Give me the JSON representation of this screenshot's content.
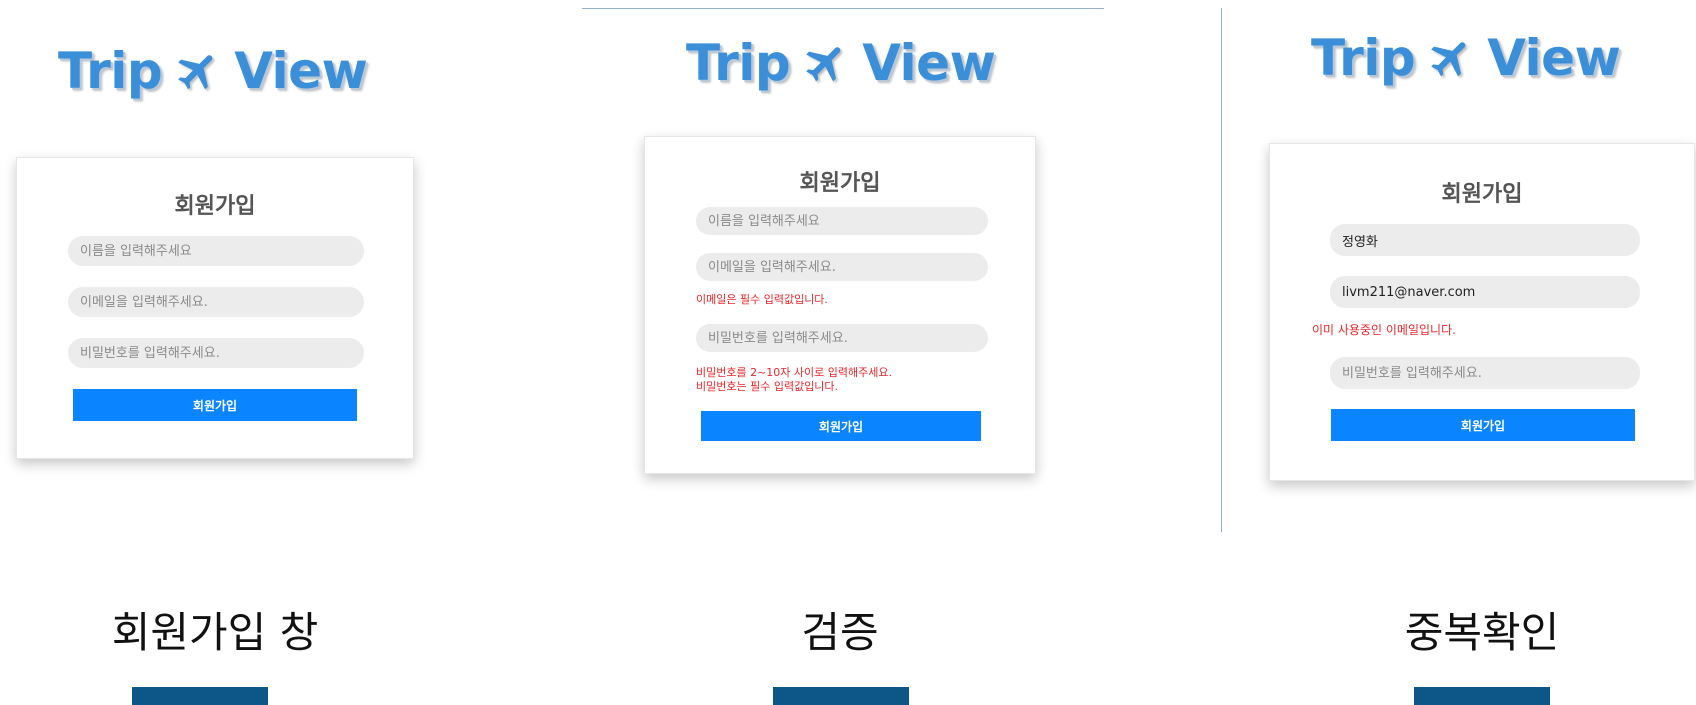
{
  "logo": {
    "part1": "Trip",
    "part2": "View"
  },
  "panels": [
    {
      "title": "회원가입",
      "name_placeholder": "이름을 입력해주세요",
      "email_placeholder": "이메일을 입력해주세요.",
      "password_placeholder": "비밀번호를 입력해주세요.",
      "button_label": "회원가입",
      "caption": "회원가입 창"
    },
    {
      "title": "회원가입",
      "name_placeholder": "이름을 입력해주세요",
      "email_placeholder": "이메일을 입력해주세요.",
      "email_error": "이메일은 필수 입력값입니다.",
      "password_placeholder": "비밀번호를 입력해주세요.",
      "password_error_1": "비밀번호를 2~10자 사이로 입력해주세요.",
      "password_error_2": "비밀번호는 필수 입력값입니다.",
      "button_label": "회원가입",
      "caption": "검증"
    },
    {
      "title": "회원가입",
      "name_value": "정영화",
      "email_value": "livm211@naver.com",
      "email_error": "이미 사용중인 이메일입니다.",
      "password_placeholder": "비밀번호를 입력해주세요.",
      "button_label": "회원가입",
      "caption": "중복확인"
    }
  ],
  "colors": {
    "logo": "#3a8fd8",
    "button": "#0b84ff",
    "error": "#e8262b",
    "bottom_bar": "#0c5788"
  }
}
